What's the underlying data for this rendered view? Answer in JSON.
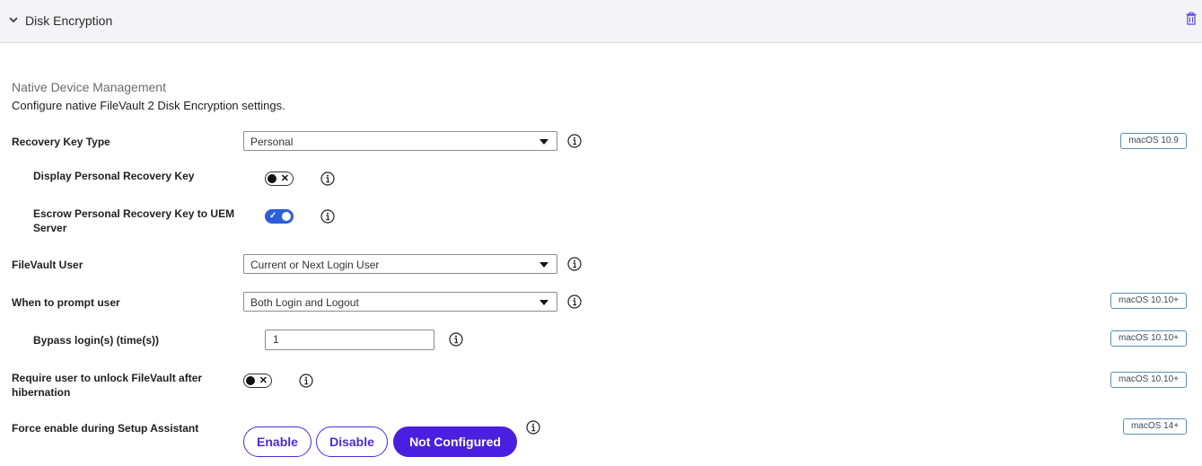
{
  "header": {
    "title": "Disk Encryption",
    "chevron_icon": "chevron-down-icon",
    "delete_icon": "trash-icon",
    "accent_color": "#5b3fe0"
  },
  "section": {
    "title": "Native Device Management",
    "description": "Configure native FileVault 2 Disk Encryption settings."
  },
  "recovery_key_type": {
    "label": "Recovery Key Type",
    "value": "Personal",
    "badge": "macOS 10.9"
  },
  "display_personal_recovery_key": {
    "label": "Display Personal Recovery Key",
    "state": "off"
  },
  "escrow_personal_recovery_key": {
    "label": "Escrow Personal Recovery Key to UEM Server",
    "state": "on"
  },
  "filevault_user": {
    "label": "FileVault User",
    "value": "Current or Next Login User"
  },
  "when_to_prompt": {
    "label": "When to prompt user",
    "value": "Both Login and Logout",
    "badge": "macOS 10.10+"
  },
  "bypass_logins": {
    "label": "Bypass login(s) (time(s))",
    "value": "1",
    "badge": "macOS 10.10+"
  },
  "require_unlock": {
    "label": "Require user to unlock FileVault after hibernation",
    "state": "off",
    "badge": "macOS 10.10+"
  },
  "force_enable": {
    "label": "Force enable during Setup Assistant",
    "options": [
      "Enable",
      "Disable",
      "Not Configured"
    ],
    "selected": "Not Configured",
    "badge": "macOS 14+"
  },
  "colors": {
    "toggle_on": "#2a5fd7",
    "segment_selected": "#4a1fe0",
    "badge_border": "#5a8fb5"
  }
}
